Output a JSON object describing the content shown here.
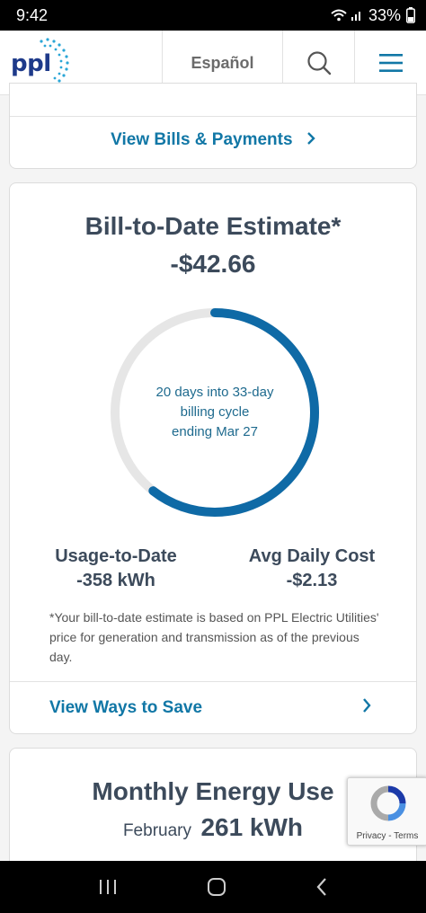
{
  "status_bar": {
    "time": "9:42",
    "battery": "33%"
  },
  "header": {
    "logo": "ppl",
    "language": "Español"
  },
  "bills_card": {
    "link_label": "View Bills & Payments"
  },
  "estimate_card": {
    "title": "Bill-to-Date Estimate*",
    "amount": "-$42.66",
    "progress_fraction": 0.606,
    "cycle_line1": "20 days into 33-day",
    "cycle_line2": "billing cycle",
    "cycle_line3": "ending Mar 27",
    "usage_label": "Usage-to-Date",
    "usage_value": "-358 kWh",
    "avg_label": "Avg Daily Cost",
    "avg_value": "-$2.13",
    "footnote": "*Your bill-to-date estimate is based on PPL Electric Utilities' price for generation and transmission as of the previous day.",
    "save_link": "View Ways to Save"
  },
  "energy_card": {
    "title": "Monthly Energy Use",
    "month": "February",
    "kwh": "261 kWh"
  },
  "recaptcha": {
    "privacy": "Privacy",
    "separator": " - ",
    "terms": "Terms"
  },
  "colors": {
    "accent": "#1177a6",
    "ring": "#0f6aa6",
    "ring_track": "#e6e6e6",
    "text": "#3c4a5b"
  }
}
